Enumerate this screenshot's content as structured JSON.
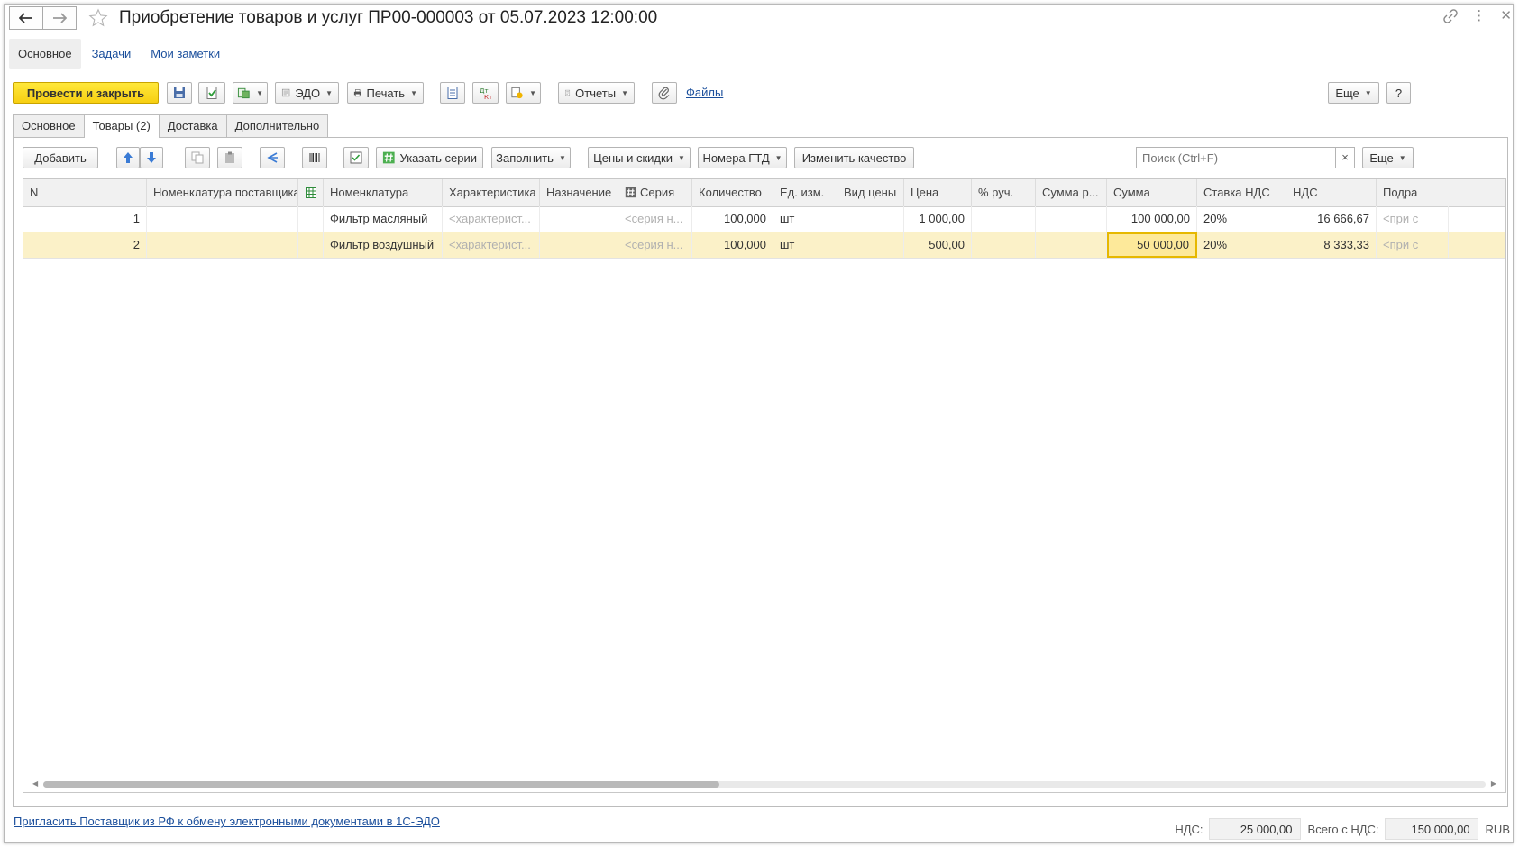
{
  "window": {
    "title": "Приобретение товаров и услуг ПР00-000003 от 05.07.2023 12:00:00"
  },
  "sections": [
    {
      "label": "Основное"
    },
    {
      "label": "Задачи"
    },
    {
      "label": "Мои заметки"
    }
  ],
  "toolbar": {
    "post_and_close": "Провести и закрыть",
    "edo": "ЭДО",
    "print": "Печать",
    "reports": "Отчеты",
    "files": "Файлы",
    "more": "Еще",
    "help": "?"
  },
  "tabs": [
    {
      "label": "Основное"
    },
    {
      "label": "Товары (2)"
    },
    {
      "label": "Доставка"
    },
    {
      "label": "Дополнительно"
    }
  ],
  "table_toolbar": {
    "add": "Добавить",
    "specify_series": "Указать серии",
    "fill": "Заполнить",
    "prices_discounts": "Цены и скидки",
    "gtd_numbers": "Номера ГТД",
    "change_quality": "Изменить качество",
    "search_placeholder": "Поиск (Ctrl+F)",
    "search_clear": "×",
    "more": "Еще"
  },
  "table": {
    "columns": [
      "N",
      "Номенклатура поставщика",
      "",
      "Номенклатура",
      "Характеристика",
      "Назначение",
      "Серия",
      "Количество",
      "Ед. изм.",
      "Вид цены",
      "Цена",
      "% руч.",
      "Сумма р...",
      "Сумма",
      "Ставка НДС",
      "НДС",
      "Подра"
    ],
    "rows": [
      {
        "n": "1",
        "supplier_item": "",
        "mark": "",
        "item": "Фильтр масляный",
        "characteristic": "<характерист...",
        "purpose": "",
        "series": "<серия н...",
        "quantity": "100,000",
        "unit": "шт",
        "price_type": "",
        "price": "1 000,00",
        "manual_pct": "",
        "manual_sum": "",
        "sum": "100 000,00",
        "vat_rate": "20%",
        "vat": "16 666,67",
        "division": "<при с"
      },
      {
        "n": "2",
        "supplier_item": "",
        "mark": "",
        "item": "Фильтр воздушный",
        "characteristic": "<характерист...",
        "purpose": "",
        "series": "<серия н...",
        "quantity": "100,000",
        "unit": "шт",
        "price_type": "",
        "price": "500,00",
        "manual_pct": "",
        "manual_sum": "",
        "sum": "50 000,00",
        "vat_rate": "20%",
        "vat": "8 333,33",
        "division": "<при с"
      }
    ]
  },
  "footer": {
    "invite_link": "Пригласить Поставщик из РФ к обмену электронными документами в 1С-ЭДО",
    "vat_label": "НДС:",
    "vat_value": "25 000,00",
    "total_label": "Всего с НДС:",
    "total_value": "150 000,00",
    "currency": "RUB"
  },
  "colors": {
    "primary_button": "#f7cf12",
    "selected_row": "#fbf1c8",
    "link": "#1b4f9c"
  }
}
